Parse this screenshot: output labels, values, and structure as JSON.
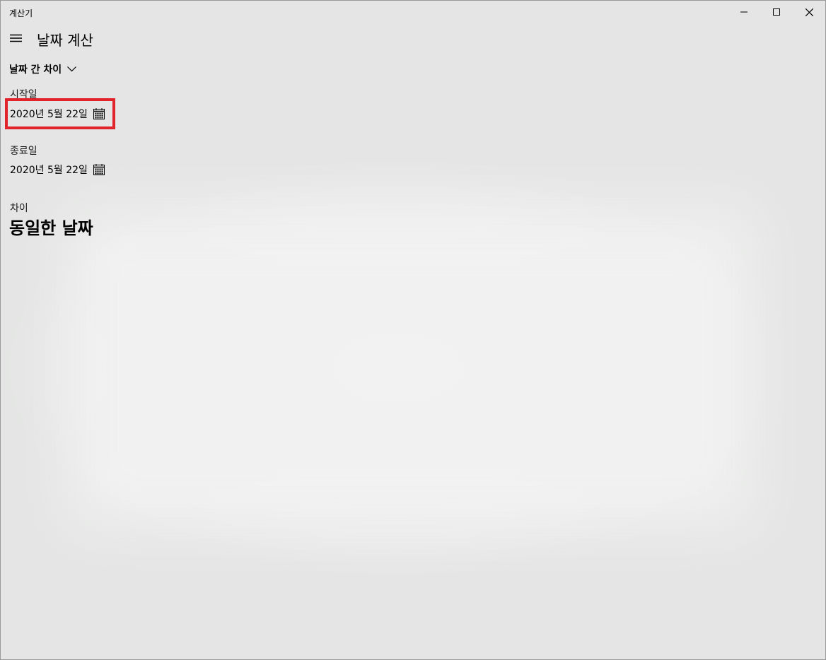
{
  "window": {
    "title": "계산기"
  },
  "header": {
    "title": "날짜 계산",
    "menu_icon": "hamburger-icon"
  },
  "mode": {
    "selected": "날짜 간 차이",
    "icon": "chevron-down-icon"
  },
  "start": {
    "label": "시작일",
    "value": "2020년 5월 22일",
    "icon": "calendar-icon"
  },
  "end": {
    "label": "종료일",
    "value": "2020년 5월 22일",
    "icon": "calendar-icon"
  },
  "difference": {
    "label": "차이",
    "value": "동일한 날짜"
  },
  "colors": {
    "highlight": "#e1242b",
    "background": "#e4e5e4"
  }
}
